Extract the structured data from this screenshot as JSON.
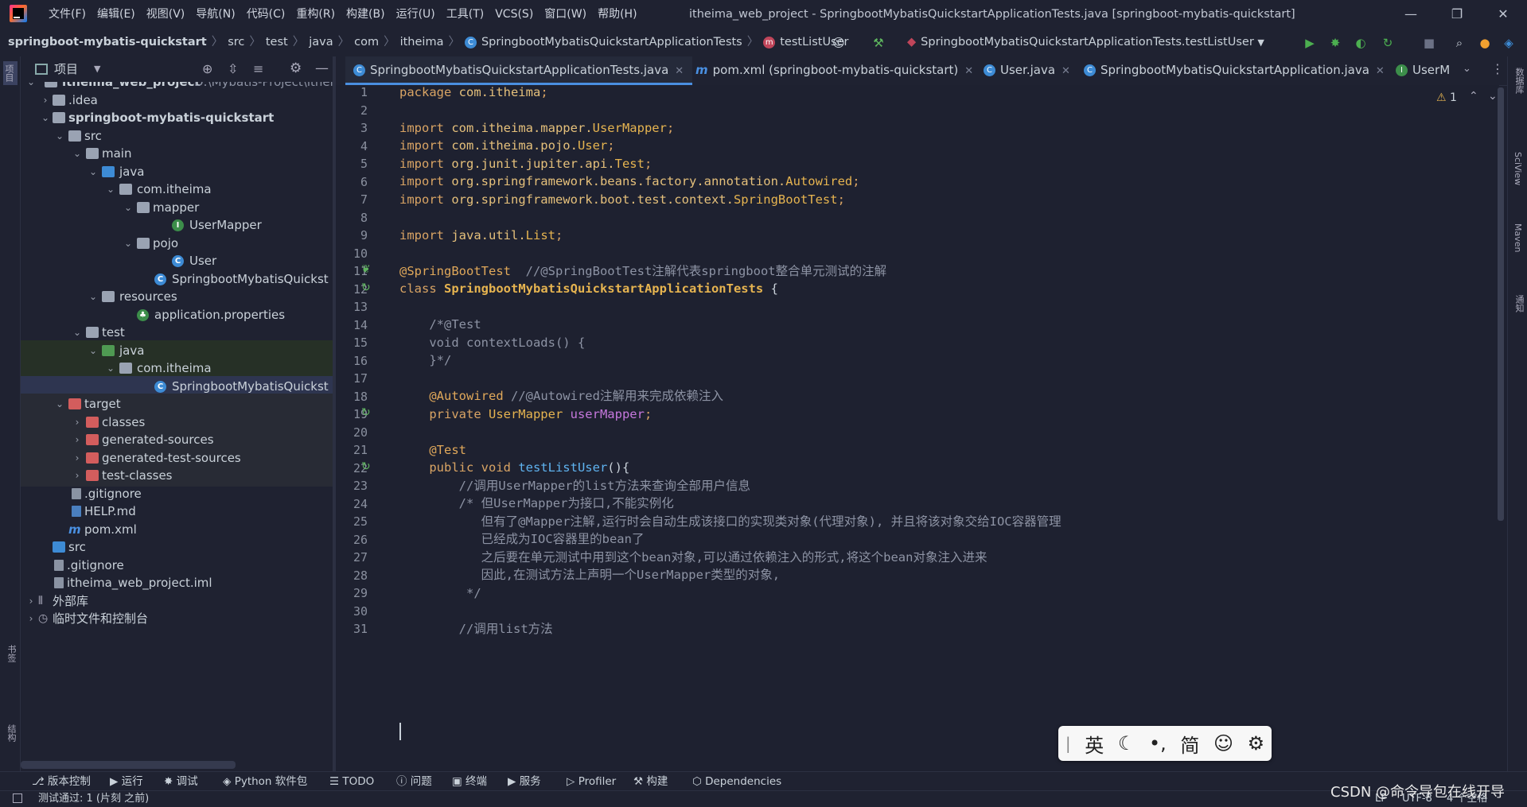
{
  "titlebar": {
    "menus": [
      "文件(F)",
      "编辑(E)",
      "视图(V)",
      "导航(N)",
      "代码(C)",
      "重构(R)",
      "构建(B)",
      "运行(U)",
      "工具(T)",
      "VCS(S)",
      "窗口(W)",
      "帮助(H)"
    ],
    "window_title": "itheima_web_project - SpringbootMybatisQuickstartApplicationTests.java [springboot-mybatis-quickstart]"
  },
  "breadcrumb": [
    "springboot-mybatis-quickstart",
    "src",
    "test",
    "java",
    "com",
    "itheima",
    "SpringbootMybatisQuickstartApplicationTests",
    "testListUser"
  ],
  "run_config": "SpringbootMybatisQuickstartApplicationTests.testListUser",
  "left_strip": {
    "project": "项目",
    "bookmarks": "书签",
    "structure": "结构"
  },
  "right_strip": {
    "database": "数据库",
    "sciview": "SciView",
    "maven": "Maven",
    "notifications": "通知"
  },
  "project_panel": {
    "title": "项目",
    "tree": [
      {
        "label": "itheima_web_project",
        "path": "D:\\Mybatis-Project\\ithei"
      },
      {
        "label": ".idea"
      },
      {
        "label": "springboot-mybatis-quickstart"
      },
      {
        "label": "src"
      },
      {
        "label": "main"
      },
      {
        "label": "java"
      },
      {
        "label": "com.itheima"
      },
      {
        "label": "mapper"
      },
      {
        "label": "UserMapper"
      },
      {
        "label": "pojo"
      },
      {
        "label": "User"
      },
      {
        "label": "SpringbootMybatisQuickst"
      },
      {
        "label": "resources"
      },
      {
        "label": "application.properties"
      },
      {
        "label": "test"
      },
      {
        "label": "java"
      },
      {
        "label": "com.itheima"
      },
      {
        "label": "SpringbootMybatisQuickst"
      },
      {
        "label": "target"
      },
      {
        "label": "classes"
      },
      {
        "label": "generated-sources"
      },
      {
        "label": "generated-test-sources"
      },
      {
        "label": "test-classes"
      },
      {
        "label": ".gitignore"
      },
      {
        "label": "HELP.md"
      },
      {
        "label": "pom.xml"
      },
      {
        "label": "src"
      },
      {
        "label": ".gitignore"
      },
      {
        "label": "itheima_web_project.iml"
      },
      {
        "label": "外部库"
      },
      {
        "label": "临时文件和控制台"
      }
    ]
  },
  "tabs": [
    "SpringbootMybatisQuickstartApplicationTests.java",
    "pom.xml (springboot-mybatis-quickstart)",
    "User.java",
    "SpringbootMybatisQuickstartApplication.java",
    "UserM"
  ],
  "inspection": {
    "warnings": "1"
  },
  "editor": {
    "line_numbers": [
      "1",
      "2",
      "3",
      "4",
      "5",
      "6",
      "7",
      "8",
      "9",
      "10",
      "11",
      "12",
      "13",
      "14",
      "15",
      "16",
      "17",
      "18",
      "19",
      "20",
      "21",
      "22",
      "23",
      "24",
      "25",
      "26",
      "27",
      "28",
      "29",
      "30",
      "31"
    ],
    "lines": {
      "l1a": "package ",
      "l1b": "com.itheima",
      "l1c": ";",
      "l3a": "import ",
      "l3b": "com.itheima.mapper.",
      "l3c": "UserMapper",
      "l3d": ";",
      "l4a": "import ",
      "l4b": "com.itheima.pojo.",
      "l4c": "User",
      "l4d": ";",
      "l5a": "import ",
      "l5b": "org.junit.jupiter.api.",
      "l5c": "Test",
      "l5d": ";",
      "l6a": "import ",
      "l6b": "org.springframework.beans.factory.annotation.",
      "l6c": "Autowired",
      "l6d": ";",
      "l7a": "import ",
      "l7b": "org.springframework.boot.test.context.",
      "l7c": "SpringBootTest",
      "l7d": ";",
      "l9a": "import ",
      "l9b": "java.util.",
      "l9c": "List",
      "l9d": ";",
      "l11a": "@SpringBootTest",
      "l11b": "  //@SpringBootTest注解代表springboot整合单元测试的注解",
      "l12a": "class ",
      "l12b": "SpringbootMybatisQuickstartApplicationTests",
      "l12c": " {",
      "l14": "    /*@Test",
      "l15": "    void contextLoads() {",
      "l16": "    }*/",
      "l18a": "    @Autowired",
      "l18b": " //@Autowired注解用来完成依赖注入",
      "l19a": "    private ",
      "l19b": "UserMapper ",
      "l19c": "userMapper",
      "l19d": ";",
      "l21": "    @Test",
      "l22a": "    public void ",
      "l22b": "testListUser",
      "l22c": "(){",
      "l23": "        //调用UserMapper的list方法来查询全部用户信息",
      "l24": "        /* 但UserMapper为接口,不能实例化",
      "l25": "           但有了@Mapper注解,运行时会自动生成该接口的实现类对象(代理对象), 并且将该对象交给IOC容器管理",
      "l26": "           已经成为IOC容器里的bean了",
      "l27": "           之后要在单元测试中用到这个bean对象,可以通过依赖注入的形式,将这个bean对象注入进来",
      "l28": "           因此,在测试方法上声明一个UserMapper类型的对象,",
      "l29": "         */",
      "l31": "        //调用list方法"
    }
  },
  "ime": [
    "英",
    "简"
  ],
  "bottom_tools": [
    "版本控制",
    "运行",
    "调试",
    "Python 软件包",
    "TODO",
    "问题",
    "终端",
    "服务",
    "Profiler",
    "构建",
    "Dependencies"
  ],
  "status": {
    "message": "测试通过: 1 (片刻 之前)",
    "line_sep": "LF",
    "encoding": "UTF-8",
    "indent": "4 个空格",
    "watermark": "CSDN @命令导包在线开导"
  },
  "colors": {
    "accent": "#4a8fe0",
    "background": "#1e2130"
  }
}
